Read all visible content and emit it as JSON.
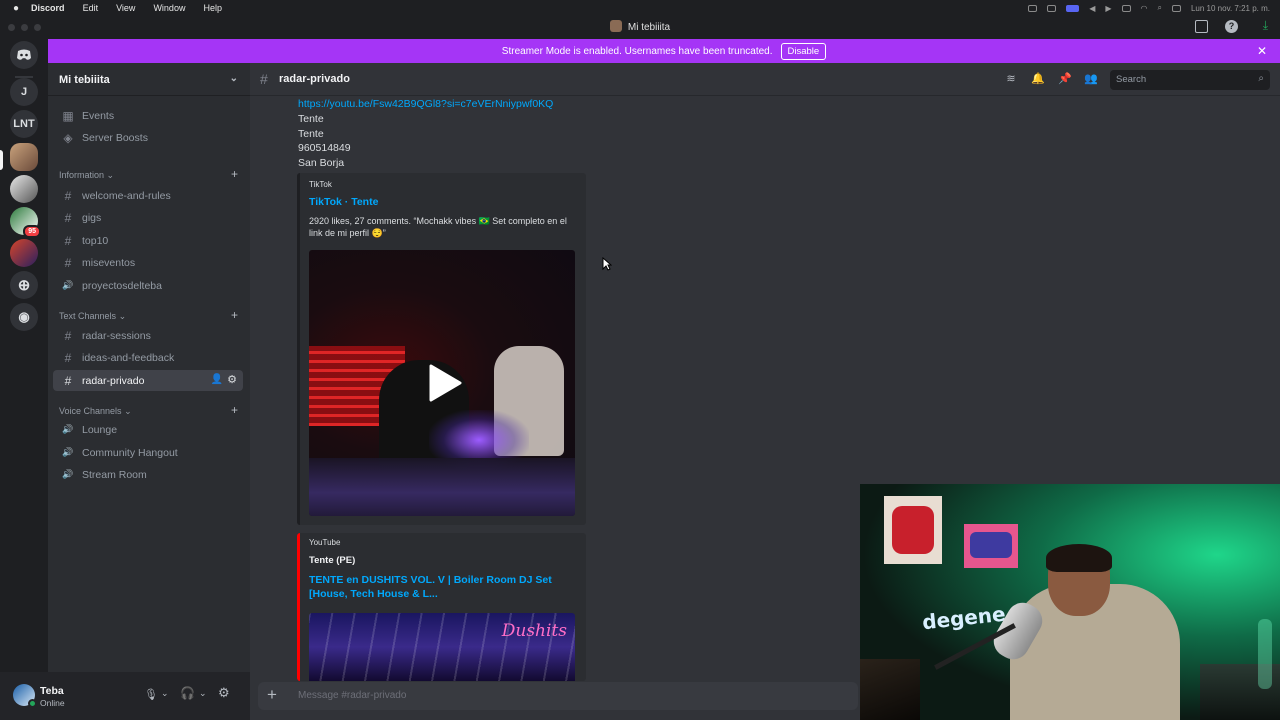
{
  "menubar": {
    "app": "Discord",
    "items": [
      "Edit",
      "View",
      "Window",
      "Help"
    ],
    "datetime": "Lun 10 nov.  7:21 p. m."
  },
  "window": {
    "title": "Mi tebiiita"
  },
  "rail": {
    "servers": [
      "J",
      "LNT"
    ],
    "badge": "95"
  },
  "banner": {
    "text": "Streamer Mode is enabled. Usernames have been truncated.",
    "button": "Disable"
  },
  "sidebar": {
    "server_name": "Mi tebiiita",
    "top_items": [
      {
        "label": "Events",
        "icon": "calendar-icon"
      },
      {
        "label": "Server Boosts",
        "icon": "boost-icon"
      }
    ],
    "categories": [
      {
        "label": "Information",
        "channels": [
          {
            "label": "welcome-and-rules",
            "icon": "#"
          },
          {
            "label": "gigs",
            "icon": "#"
          },
          {
            "label": "top10",
            "icon": "#"
          },
          {
            "label": "miseventos",
            "icon": "#"
          },
          {
            "label": "proyectosdelteba",
            "icon": "🔊"
          }
        ]
      },
      {
        "label": "Text Channels",
        "channels": [
          {
            "label": "radar-sessions",
            "icon": "#"
          },
          {
            "label": "ideas-and-feedback",
            "icon": "#"
          },
          {
            "label": "radar-privado",
            "icon": "#",
            "selected": true
          }
        ]
      },
      {
        "label": "Voice Channels",
        "channels": [
          {
            "label": "Lounge",
            "icon": "🔊"
          },
          {
            "label": "Community Hangout",
            "icon": "🔊"
          },
          {
            "label": "Stream Room",
            "icon": "🔊"
          }
        ]
      }
    ]
  },
  "user": {
    "name": "Teba",
    "status": "Online"
  },
  "header": {
    "channel": "radar-privado",
    "search_placeholder": "Search"
  },
  "messages": {
    "link": "https://youtu.be/Fsw42B9QGl8?si=c7eVErNniypwf0KQ",
    "lines": [
      "Tente",
      "Tente",
      "960514849",
      "San Borja"
    ],
    "tiktok": {
      "provider": "TikTok",
      "title": "TikTok · Tente",
      "description": "2920 likes, 27 comments. “Mochakk vibes 🇧🇷 Set completo en el link de mi perfil 😌”"
    },
    "youtube": {
      "provider": "YouTube",
      "author": "Tente (PE)",
      "title": "TENTE en DUSHITS VOL. V | Boiler Room DJ Set [House, Tech House & L..."
    }
  },
  "composer": {
    "placeholder": "Message #radar-privado"
  },
  "colors": {
    "banner": "#a535f6",
    "link": "#00a8fc",
    "youtube_bar": "#ff0000",
    "online": "#23a55a"
  }
}
